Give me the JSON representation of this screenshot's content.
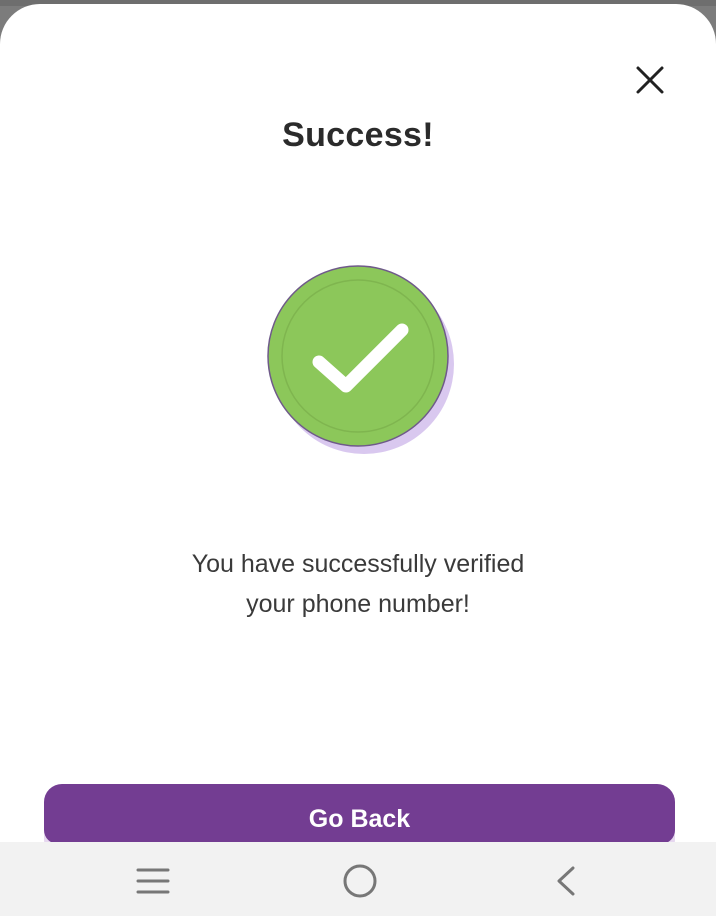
{
  "dialog": {
    "title": "Success!",
    "message_line1": "You have successfully verified",
    "message_line2": "your phone number!",
    "close_icon": "close-icon",
    "status_icon": "success-check-icon"
  },
  "actions": {
    "go_back_label": "Go Back"
  },
  "system_nav": {
    "items": [
      "recent-apps-icon",
      "home-icon",
      "back-icon"
    ]
  },
  "colors": {
    "accent": "#733d92",
    "accent_light": "#e6d7ef",
    "success": "#8cc75a",
    "success_shadow": "#d9c8ef",
    "title_text": "#2b2b2b",
    "body_text": "#3a3a3a",
    "navbar_bg": "#f2f2f2",
    "nav_icon": "#777777"
  }
}
